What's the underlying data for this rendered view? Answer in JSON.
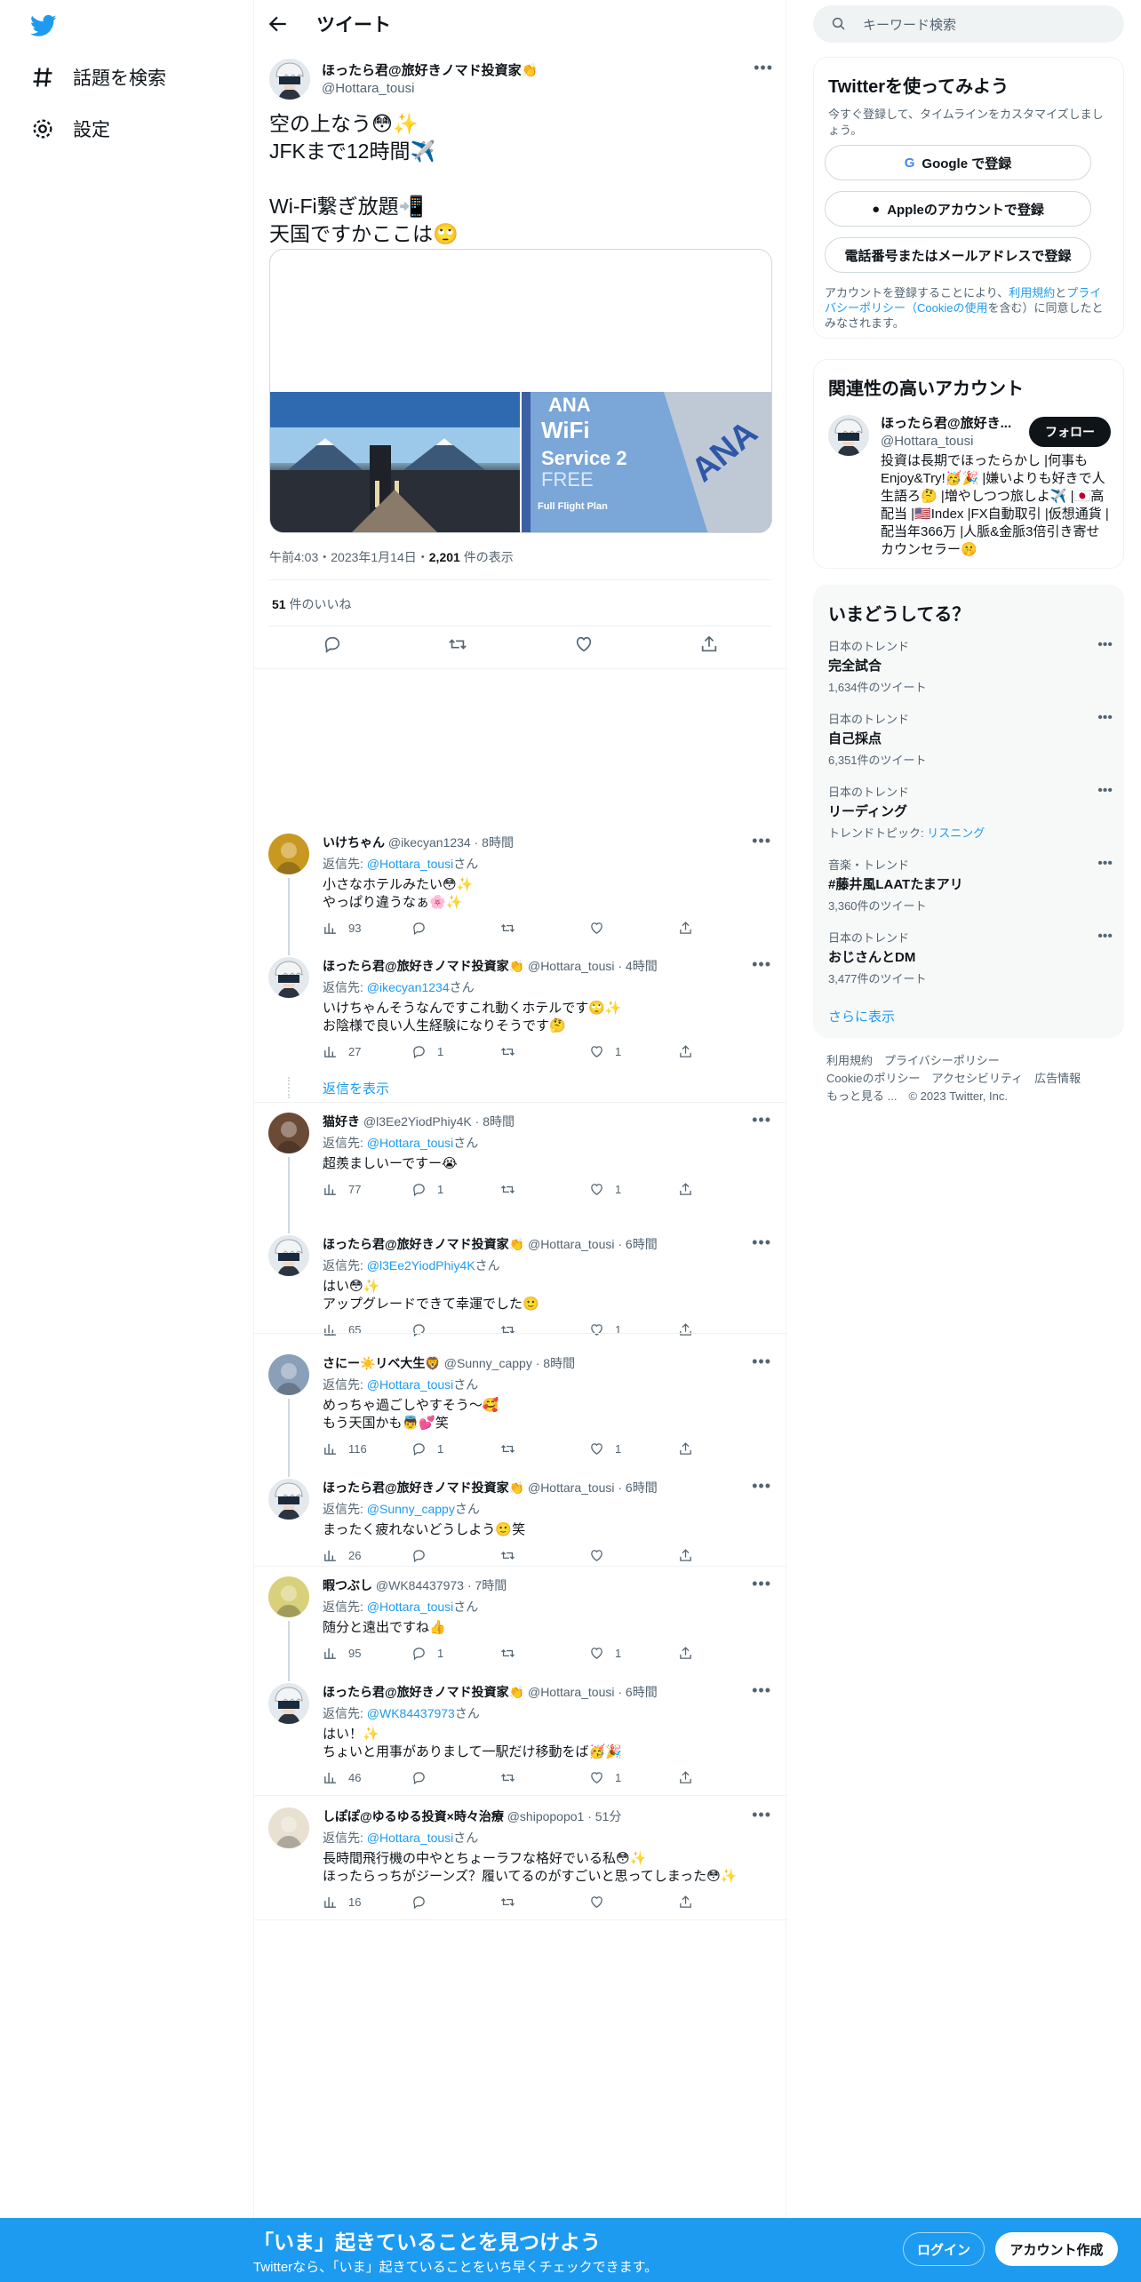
{
  "nav": {
    "explore_label": "話題を検索",
    "settings_label": "設定"
  },
  "header": {
    "title": "ツイート"
  },
  "tweet": {
    "display_name": "ほったら君@旅好きノマド投資家👏",
    "handle": "@Hottara_tousi",
    "text": "空の上なう😳✨\nJFKまで12時間✈️\n\nWi-Fi繋ぎ放題📲\n天国ですかここは🙄",
    "meta": "午前4:03・2023年1月14日・",
    "views_count": "2,201",
    "views_label": " 件の表示",
    "likes_count": "51",
    "likes_label": " 件のいいね"
  },
  "replies": [
    {
      "name": "いけちゃん",
      "handle": "@ikecyan1234",
      "time": "8時間",
      "reply_to": "@Hottara_tousi",
      "text": "小さなホテルみたい😳✨\nやっぱり違うなぁ🌸✨",
      "views": "93",
      "replies": "",
      "retweets": "",
      "likes": ""
    },
    {
      "name": "ほったら君@旅好きノマド投資家👏",
      "handle": "@Hottara_tousi",
      "time": "4時間",
      "reply_to": "@ikecyan1234",
      "text": "いけちゃんそうなんですこれ動くホテルです🙄✨\nお陰様で良い人生経験になりそうです🤔",
      "views": "27",
      "replies": "1",
      "retweets": "",
      "likes": "1"
    },
    {
      "name": "猫好き",
      "handle": "@l3Ee2YiodPhiy4K",
      "time": "8時間",
      "reply_to": "@Hottara_tousi",
      "text": "超羨ましいーですー😭",
      "views": "77",
      "replies": "1",
      "retweets": "",
      "likes": "1"
    },
    {
      "name": "ほったら君@旅好きノマド投資家👏",
      "handle": "@Hottara_tousi",
      "time": "6時間",
      "reply_to": "@l3Ee2YiodPhiy4K",
      "text": "はい😳✨\nアップグレードできて幸運でした🙂",
      "views": "65",
      "replies": "",
      "retweets": "",
      "likes": "1"
    },
    {
      "name": "さにー☀️リベ大生🦁",
      "handle": "@Sunny_cappy",
      "time": "8時間",
      "reply_to": "@Hottara_tousi",
      "text": "めっちゃ過ごしやすそう～🥰\nもう天国かも👼💕笑",
      "views": "116",
      "replies": "1",
      "retweets": "",
      "likes": "1"
    },
    {
      "name": "ほったら君@旅好きノマド投資家👏",
      "handle": "@Hottara_tousi",
      "time": "6時間",
      "reply_to": "@Sunny_cappy",
      "text": "まったく疲れないどうしよう🙂笑",
      "views": "26",
      "replies": "",
      "retweets": "",
      "likes": ""
    },
    {
      "name": "暇つぶし",
      "handle": "@WK84437973",
      "time": "7時間",
      "reply_to": "@Hottara_tousi",
      "text": "随分と遠出ですね👍",
      "views": "95",
      "replies": "1",
      "retweets": "",
      "likes": "1"
    },
    {
      "name": "ほったら君@旅好きノマド投資家👏",
      "handle": "@Hottara_tousi",
      "time": "6時間",
      "reply_to": "@WK84437973",
      "text": "はい！✨\nちょいと用事がありまして一駅だけ移動をば🥳🎉",
      "views": "46",
      "replies": "",
      "retweets": "",
      "likes": "1"
    },
    {
      "name": "しぽぽ@ゆるゆる投資×時々治療",
      "handle": "@shipopopo1",
      "time": "51分",
      "reply_to": "@Hottara_tousi",
      "text": "長時間飛行機の中やとちょーラフな格好でいる私😳✨\nほったらっちがジーンズ？履いてるのがすごいと思ってしまった😳✨",
      "views": "16",
      "replies": "",
      "retweets": "",
      "likes": ""
    }
  ],
  "reply_prefix": "返信先: ",
  "reply_suffix": "さん",
  "show_replies": "返信を表示",
  "search": {
    "placeholder": "キーワード検索"
  },
  "signup_box": {
    "title": "Twitterを使ってみよう",
    "subtitle": "今すぐ登録して、タイムラインをカスタマイズしましょう。",
    "google": "Google で登録",
    "apple": "Appleのアカウントで登録",
    "phone": "電話番号またはメールアドレスで登録",
    "terms_pre": "アカウントを登録することにより、",
    "terms_link": "利用規約",
    "terms_and": "と",
    "privacy_link": "プライバシーポリシー（Cookieの使用",
    "terms_post": "を含む）に同意したとみなされます。"
  },
  "relevant": {
    "title": "関連性の高いアカウント",
    "name": "ほったら君@旅好き...",
    "handle": "@Hottara_tousi",
    "follow": "フォロー",
    "bio": "投資は長期でほったらかし |何事もEnjoy&Try!🥳🎉 |嫌いよりも好きで人生語ろ🤔 |増やしつつ旅しよ✈️ |🇯🇵高配当 |🇺🇸Index |FX自動取引 |仮想通貨 |配当年366万 |人脈&金脈3倍引き寄せカウンセラー🤫"
  },
  "trends": {
    "title": "いまどうしてる？",
    "items": [
      {
        "context": "日本のトレンド",
        "name": "完全試合",
        "count": "1,634件のツイート"
      },
      {
        "context": "日本のトレンド",
        "name": "自己採点",
        "count": "6,351件のツイート"
      },
      {
        "context": "日本のトレンド",
        "name": "リーディング",
        "count": "トレンドトピック: ",
        "topic": "リスニング"
      },
      {
        "context": "音楽・トレンド",
        "name": "#藤井風LAATたまアリ",
        "count": "3,360件のツイート"
      },
      {
        "context": "日本のトレンド",
        "name": "おじさんとDM",
        "count": "3,477件のツイート"
      }
    ],
    "show_more": "さらに表示"
  },
  "footer": {
    "terms": "利用規約",
    "privacy": "プライバシーポリシー",
    "cookie": "Cookieのポリシー",
    "access": "アクセシビリティ",
    "ads": "広告情報",
    "more": "もっと見る ...",
    "copyright": "© 2023 Twitter, Inc."
  },
  "bottom_bar": {
    "title": "「いま」起きていることを見つけよう",
    "subtitle": "Twitterなら、「いま」起きていることをいち早くチェックできます。",
    "login": "ログイン",
    "signup": "アカウント作成"
  },
  "colors": {
    "accent": "#1d9bf0",
    "text": "#0f1419",
    "muted": "#536471"
  }
}
